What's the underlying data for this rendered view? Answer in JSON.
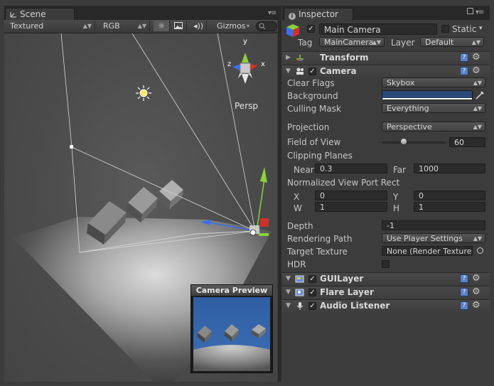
{
  "scene_tab": {
    "label": "Scene"
  },
  "inspector_tab": {
    "label": "Inspector"
  },
  "scene_toolbar": {
    "draw_mode": "Textured",
    "render_mode": "RGB",
    "gizmos_label": "Gizmos",
    "icons": [
      "sun-icon",
      "image-icon",
      "audio-icon"
    ]
  },
  "scene_view": {
    "projection_label": "Persp",
    "axis_labels": {
      "x": "x",
      "y": "y",
      "z": "z"
    }
  },
  "camera_preview": {
    "title": "Camera Preview"
  },
  "game_object": {
    "active": true,
    "name": "Main Camera",
    "static_label": "Static",
    "static": false,
    "tag_label": "Tag",
    "tag": "MainCamera",
    "layer_label": "Layer",
    "layer": "Default"
  },
  "components": {
    "transform": {
      "name": "Transform"
    },
    "camera": {
      "name": "Camera",
      "enabled": true,
      "fields": {
        "clear_flags": {
          "label": "Clear Flags",
          "value": "Skybox"
        },
        "background": {
          "label": "Background",
          "color": "#2c4a78"
        },
        "culling_mask": {
          "label": "Culling Mask",
          "value": "Everything"
        },
        "projection": {
          "label": "Projection",
          "value": "Perspective"
        },
        "fov": {
          "label": "Field of View",
          "value": "60"
        },
        "clipping_planes": {
          "label": "Clipping Planes",
          "near_label": "Near",
          "near": "0.3",
          "far_label": "Far",
          "far": "1000"
        },
        "viewport": {
          "label": "Normalized View Port Rect",
          "x_label": "X",
          "x": "0",
          "y_label": "Y",
          "y": "0",
          "w_label": "W",
          "w": "1",
          "h_label": "H",
          "h": "1"
        },
        "depth": {
          "label": "Depth",
          "value": "-1"
        },
        "rendering_path": {
          "label": "Rendering Path",
          "value": "Use Player Settings"
        },
        "target_texture": {
          "label": "Target Texture",
          "value": "None (Render Texture)"
        },
        "hdr": {
          "label": "HDR",
          "value": false
        }
      }
    },
    "gui_layer": {
      "name": "GUILayer",
      "enabled": true
    },
    "flare_layer": {
      "name": "Flare Layer",
      "enabled": true
    },
    "audio_listener": {
      "name": "Audio Listener",
      "enabled": true
    }
  },
  "colors": {
    "background": "#3c3c3c",
    "panel_dark": "#282828",
    "accent_blue": "#5c7fbf",
    "camera_bg": "#2c4a78"
  }
}
